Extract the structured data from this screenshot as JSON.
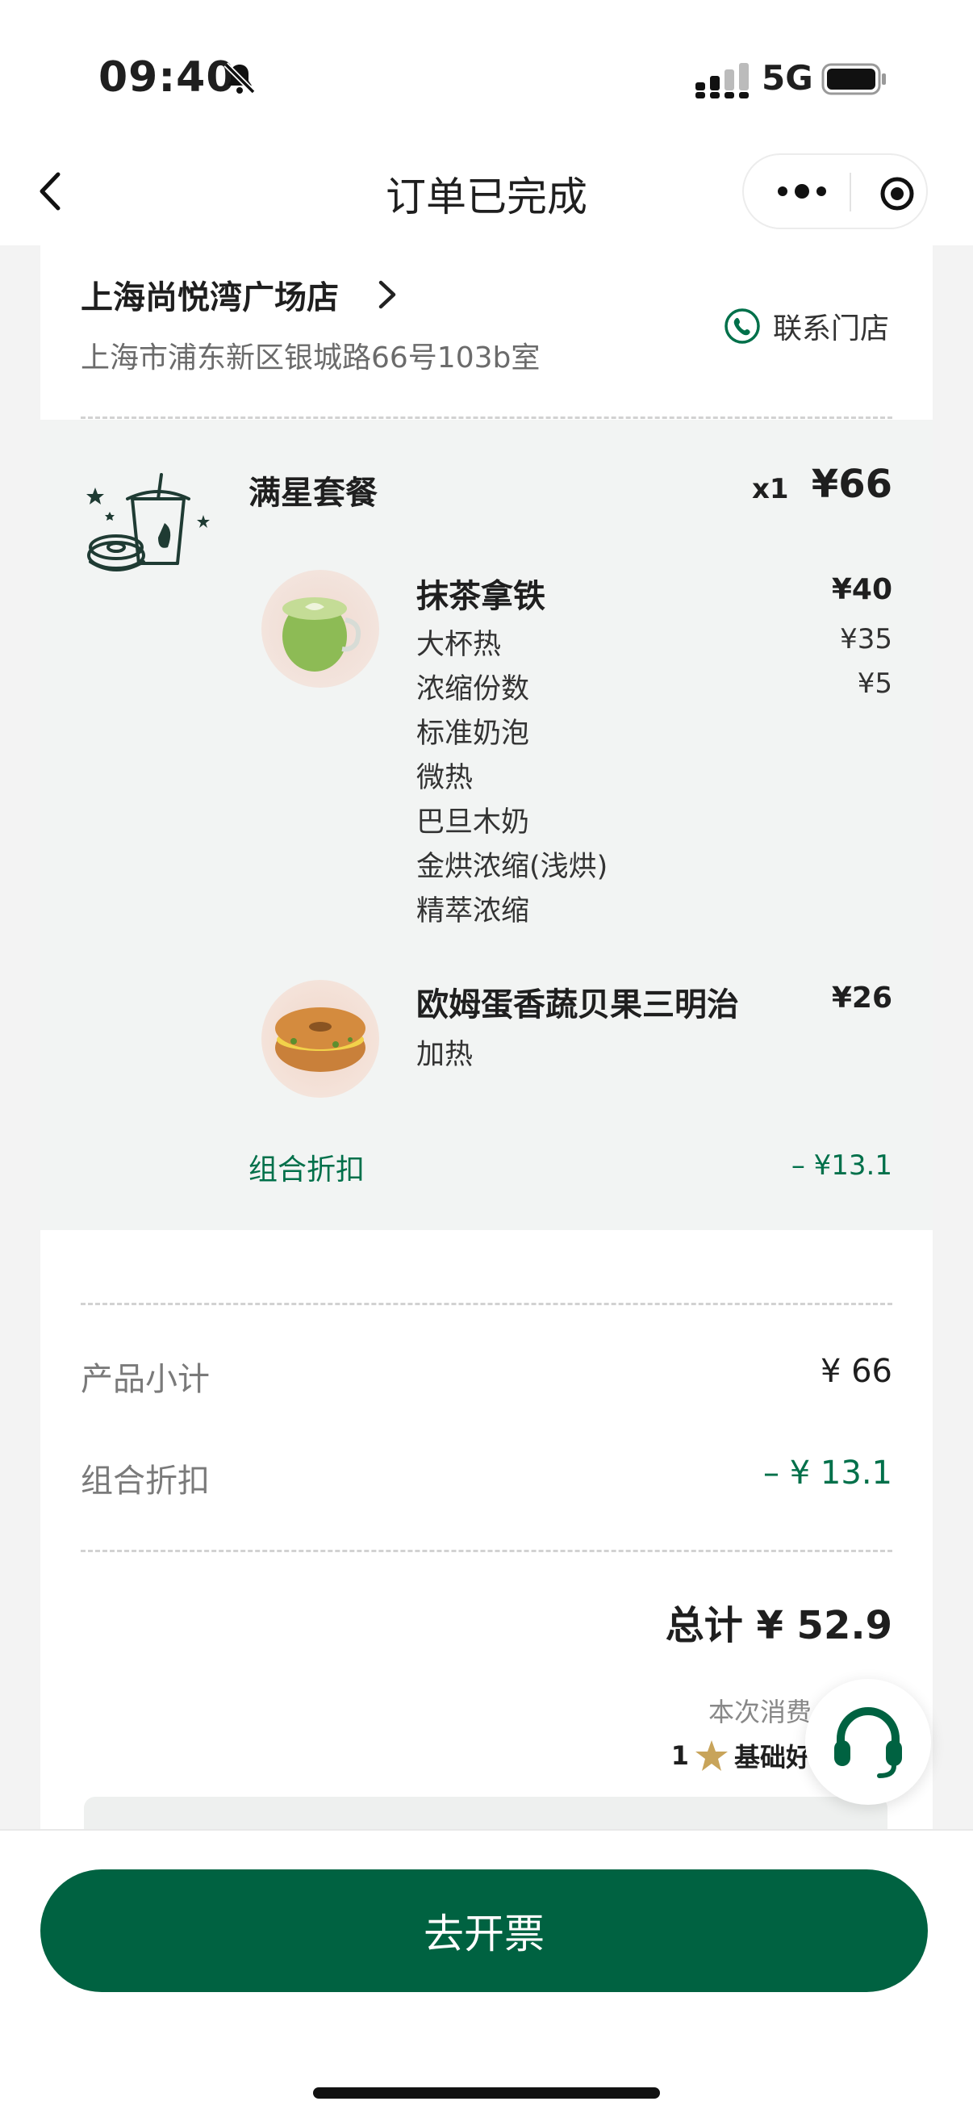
{
  "status_bar": {
    "time": "09:40",
    "network": "5G",
    "icons": [
      "mute-icon",
      "signal-icon",
      "battery-icon"
    ]
  },
  "nav": {
    "title": "订单已完成",
    "icons": [
      "back-icon",
      "more-icon",
      "target-icon"
    ]
  },
  "store": {
    "name": "上海尚悦湾广场店",
    "address": "上海市浦东新区银城路66号103b室",
    "contact_label": "联系门店"
  },
  "combo": {
    "name": "满星套餐",
    "qty": "x1",
    "price": "¥66",
    "products": [
      {
        "name": "抹茶拿铁",
        "price": "¥40",
        "options": [
          {
            "label": "大杯热",
            "price": "¥35"
          },
          {
            "label": "浓缩份数",
            "price": "¥5"
          },
          {
            "label": "标准奶泡",
            "price": ""
          },
          {
            "label": "微热",
            "price": ""
          },
          {
            "label": "巴旦木奶",
            "price": ""
          },
          {
            "label": "金烘浓缩(浅烘)",
            "price": ""
          },
          {
            "label": "精萃浓缩",
            "price": ""
          }
        ]
      },
      {
        "name": "欧姆蛋香蔬贝果三明治",
        "price": "¥26",
        "options": [
          {
            "label": "加热",
            "price": ""
          }
        ]
      }
    ],
    "discount_label": "组合折扣",
    "discount_value": "– ¥13.1"
  },
  "summary": {
    "subtotal_label": "产品小计",
    "subtotal_value": "¥ 66",
    "discount_label": "组合折扣",
    "discount_value": "– ¥ 13.1",
    "total": "总计 ¥ 52.9",
    "spend_note": "本次消费",
    "stars_count": "1",
    "stars_label": "基础好"
  },
  "bottom": {
    "invoice_button": "去开票"
  },
  "colors": {
    "brand_green": "#006241",
    "accent_green": "#00704A",
    "star_gold": "#C8A45A"
  }
}
